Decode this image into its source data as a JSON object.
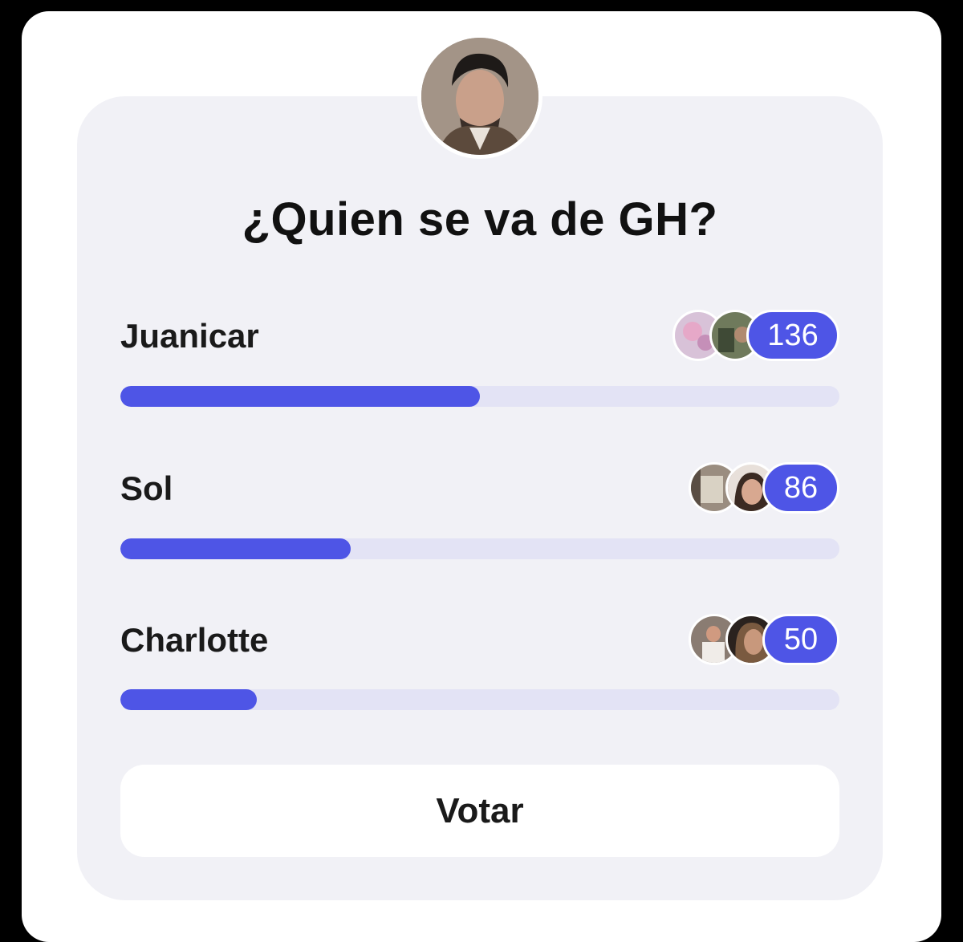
{
  "poll": {
    "question": "¿Quien se va de GH?",
    "avatar_icon": "profile-photo",
    "accent_color": "#4e55e6",
    "track_color": "#e3e3f5",
    "options": [
      {
        "label": "Juanicar",
        "votes": "136",
        "fraction": 0.5
      },
      {
        "label": "Sol",
        "votes": "86",
        "fraction": 0.32
      },
      {
        "label": "Charlotte",
        "votes": "50",
        "fraction": 0.19
      }
    ],
    "vote_button_label": "Votar"
  }
}
